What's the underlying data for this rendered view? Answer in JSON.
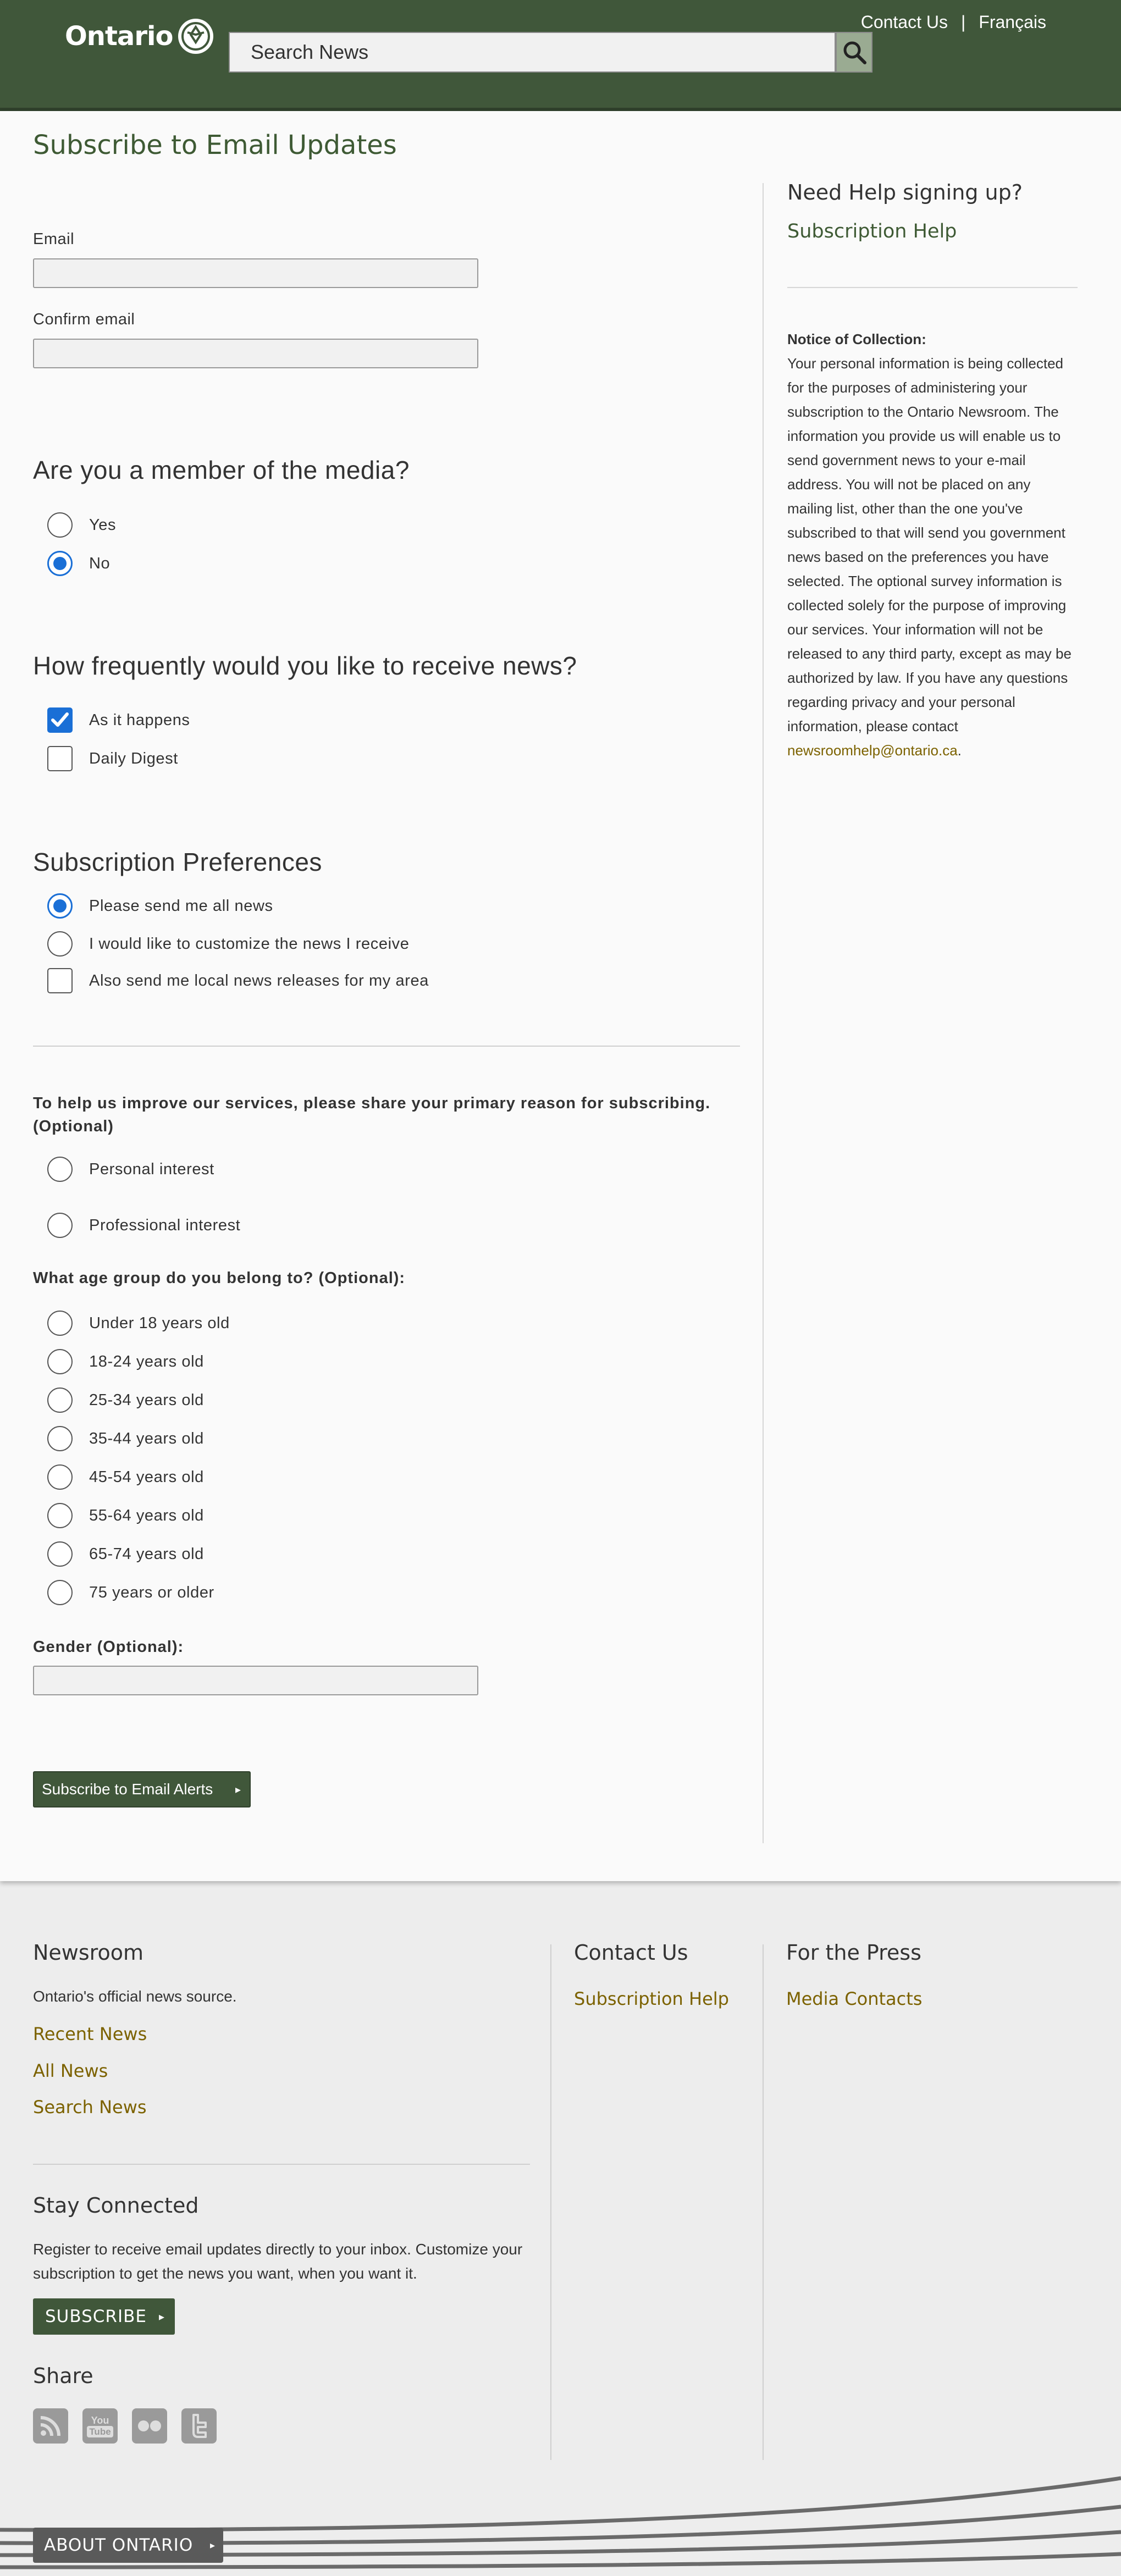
{
  "header": {
    "logo_text": "Ontario",
    "contact_us": "Contact Us",
    "separator": "|",
    "francais": "Français",
    "search_placeholder": "Search News"
  },
  "form": {
    "title": "Subscribe to Email Updates",
    "email_label": "Email",
    "confirm_email_label": "Confirm email",
    "media_question": "Are you a member of the media?",
    "media_options": [
      "Yes",
      "No"
    ],
    "media_selected": "No",
    "frequency_question": "How frequently would you like to receive news?",
    "frequency_options": [
      "As it happens",
      "Daily Digest"
    ],
    "frequency_checked": [
      "As it happens"
    ],
    "preferences_heading": "Subscription Preferences",
    "preference_options": [
      "Please send me all news",
      "I would like to customize the news I receive"
    ],
    "preference_selected": "Please send me all news",
    "local_news_label": "Also send me local news releases for my area",
    "local_news_checked": false,
    "reason_question": "To help us improve our services, please share your primary reason for subscribing. (Optional)",
    "reason_options": [
      "Personal interest",
      "Professional interest"
    ],
    "age_question": "What age group do you belong to? (Optional):",
    "age_options": [
      "Under 18 years old",
      "18-24 years old",
      "25-34 years old",
      "35-44 years old",
      "45-54 years old",
      "55-64 years old",
      "65-74 years old",
      "75 years or older"
    ],
    "gender_label": "Gender (Optional):",
    "subscribe_button": "Subscribe to Email Alerts"
  },
  "sidebar": {
    "help_title": "Need Help signing up?",
    "help_link": "Subscription Help",
    "notice_title": "Notice of Collection:",
    "notice_body": "Your personal information is being collected for the purposes of administering your subscription to the Ontario Newsroom. The information you provide us will enable us to send government news to your e-mail address. You will not be placed on any mailing list, other than the one you've subscribed to that will send you government news based on the preferences you have selected. The optional survey information is collected solely for the purpose of improving our services. Your information will not be released to any third party, except as may be authorized by law. If you have any questions regarding privacy and your personal information, please contact",
    "notice_email": "newsroomhelp@ontario.ca",
    "notice_end": "."
  },
  "footer": {
    "newsroom_title": "Newsroom",
    "newsroom_tagline": "Ontario's official news source.",
    "newsroom_links": [
      "Recent News",
      "All News",
      "Search News"
    ],
    "contact_title": "Contact Us",
    "contact_link": "Subscription Help",
    "press_title": "For the Press",
    "press_link": "Media Contacts",
    "stay_title": "Stay Connected",
    "stay_text": "Register to receive email updates directly to your inbox. Customize your subscription to get the news you want, when you want it.",
    "subscribe_button": "SUBSCRIBE",
    "share_title": "Share",
    "social_icons": [
      "rss-icon",
      "youtube-icon",
      "flickr-icon",
      "twitter-icon"
    ],
    "youtube_icon_text": [
      "You",
      "Tube"
    ],
    "about_button": "ABOUT ONTARIO"
  },
  "colors": {
    "header_green": "#40573a",
    "title_green": "#3e5a34",
    "link_gold": "#7c6200",
    "selection_blue": "#1a6fd6"
  }
}
